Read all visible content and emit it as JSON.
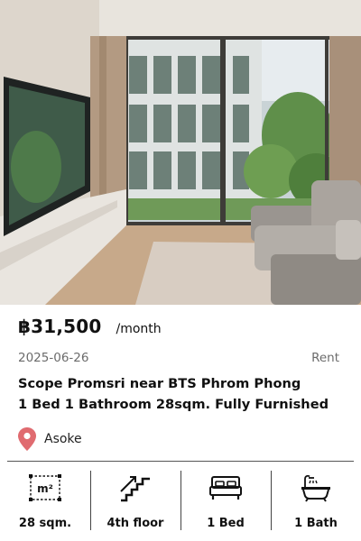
{
  "listing": {
    "price": "฿31,500",
    "period": "/month",
    "date": "2025-06-26",
    "type": "Rent",
    "title_line1": "Scope Promsri near BTS Phrom Phong",
    "title_line2": "1 Bed 1 Bathroom 28sqm. Fully Furnished",
    "location": "Asoke"
  },
  "features": {
    "size_icon_text": "m²",
    "size": "28 sqm.",
    "floor": "4th floor",
    "beds": "1 Bed",
    "baths": "1 Bath"
  },
  "icons": {
    "location": "map-pin-icon",
    "size": "area-icon",
    "floor": "stairs-icon",
    "beds": "bed-icon",
    "baths": "bathtub-icon"
  },
  "colors": {
    "pin": "#e06b70",
    "text": "#111111",
    "muted": "#6b6b6b"
  }
}
